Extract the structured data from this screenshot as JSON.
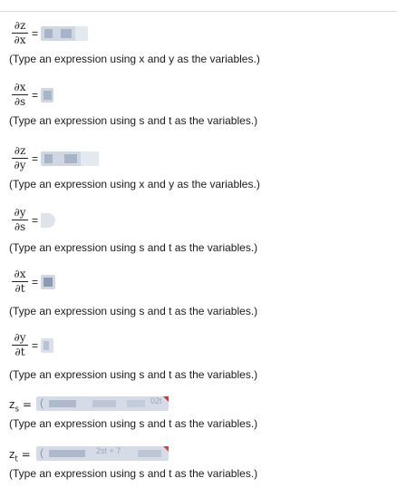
{
  "questions": [
    {
      "numerator": "∂z",
      "denominator": "∂x",
      "equals": "=",
      "hint": "(Type an expression using x and y as the variables.)"
    },
    {
      "numerator": "∂x",
      "denominator": "∂s",
      "equals": "=",
      "hint": "(Type an expression using s and t as the variables.)"
    },
    {
      "numerator": "∂z",
      "denominator": "∂y",
      "equals": "=",
      "hint": "(Type an expression using x and y as the variables.)"
    },
    {
      "numerator": "∂y",
      "denominator": "∂s",
      "equals": "=",
      "hint": "(Type an expression using s and t as the variables.)"
    },
    {
      "numerator": "∂x",
      "denominator": "∂t",
      "equals": "=",
      "hint": "(Type an expression using s and t as the variables.)"
    },
    {
      "numerator": "∂y",
      "denominator": "∂t",
      "equals": "=",
      "hint": "(Type an expression using s and t as the variables.)"
    }
  ],
  "results": [
    {
      "var": "z",
      "sub": "s",
      "equals": "=",
      "open": "(",
      "tail": "02t",
      "hint": "(Type an expression using s and t as the variables.)"
    },
    {
      "var": "z",
      "sub": "t",
      "equals": "=",
      "open": "(",
      "tail": "2st + 7",
      "hint": "(Type an expression using s and t as the variables.)"
    }
  ]
}
